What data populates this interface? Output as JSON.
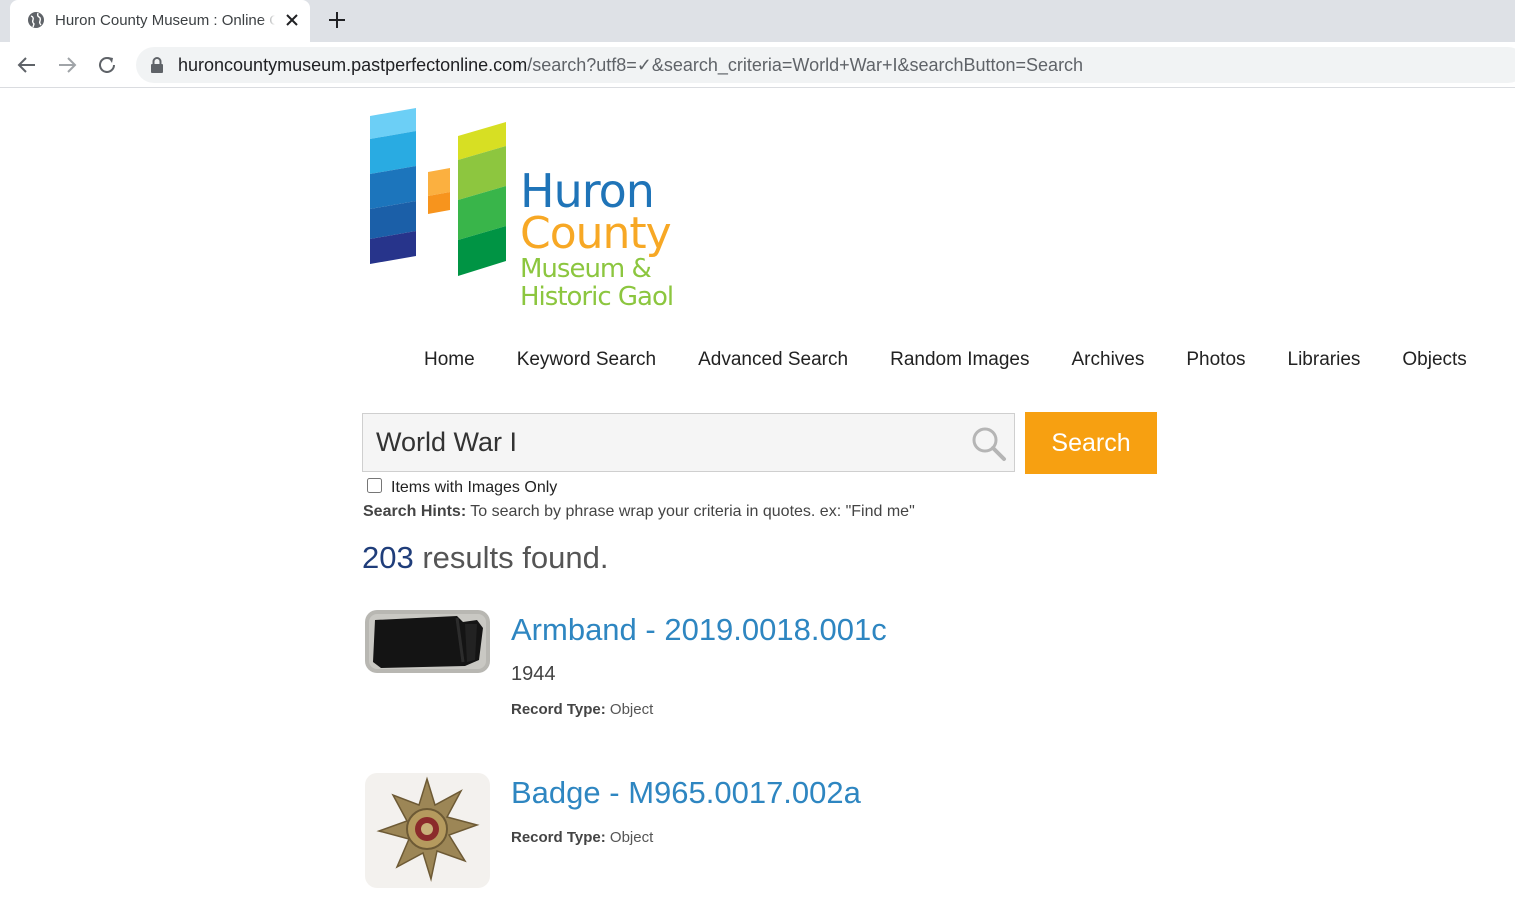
{
  "browser": {
    "tab_title": "Huron County Museum : Online Collections",
    "url_host": "huroncountymuseum.pastperfectonline.com",
    "url_path": "/search?utf8=✓&search_criteria=World+War+I&searchButton=Search"
  },
  "logo": {
    "line1": "Huron",
    "line2": "County",
    "line3": "Museum &",
    "line4": "Historic Gaol"
  },
  "nav": {
    "items": [
      "Home",
      "Keyword Search",
      "Advanced Search",
      "Random Images",
      "Archives",
      "Photos",
      "Libraries",
      "Objects"
    ]
  },
  "search": {
    "query": "World War I",
    "button_label": "Search",
    "images_only_label": "Items with Images Only",
    "images_only_checked": false,
    "hints_label": "Search Hints:",
    "hints_text": "To search by phrase wrap your criteria in quotes. ex: \"Find me\""
  },
  "results": {
    "count": "203",
    "count_suffix": "results found.",
    "record_type_label": "Record Type:",
    "items": [
      {
        "title": "Armband - 2019.0018.001c",
        "date": "1944",
        "record_type": "Object"
      },
      {
        "title": "Badge - M965.0017.002a",
        "record_type": "Object"
      }
    ]
  },
  "colors": {
    "accent_orange": "#f7a011",
    "link_blue": "#2e86c1",
    "count_blue": "#1f3d7a"
  },
  "icons": [
    "globe-icon",
    "close-icon",
    "plus-icon",
    "back-arrow-icon",
    "forward-arrow-icon",
    "reload-icon",
    "lock-icon",
    "search-icon"
  ]
}
